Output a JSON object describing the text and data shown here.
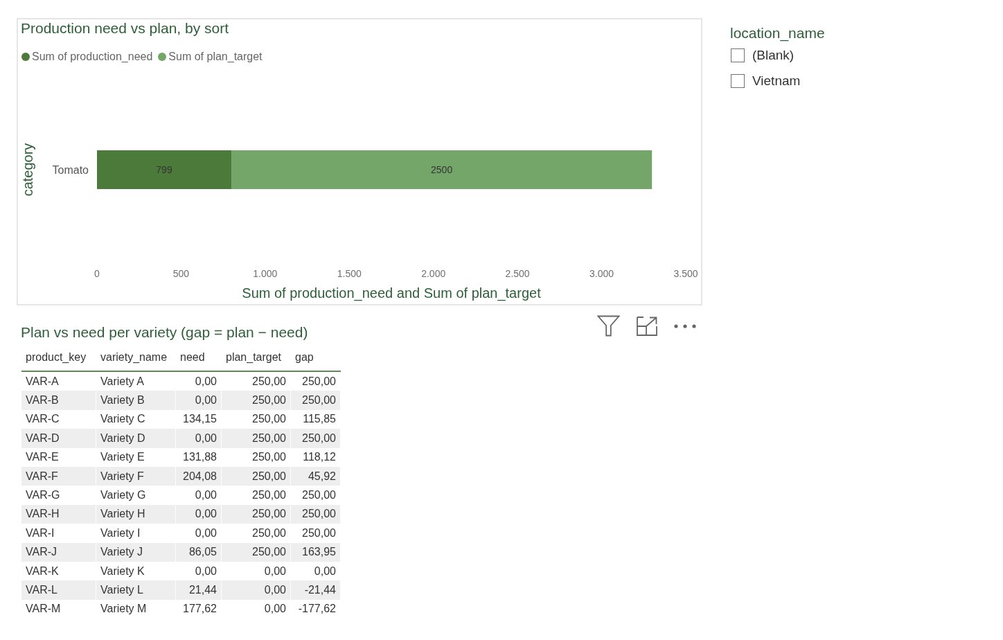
{
  "production_chart": {
    "chart_data": {
      "type": "bar",
      "orientation": "horizontal",
      "stacked": true,
      "title": "Production need vs plan, by sort",
      "legend": "top-left",
      "xlabel": "Sum of production_need and Sum of plan_target",
      "ylabel": "category",
      "categories": [
        "Tomato"
      ],
      "series": [
        {
          "name": "Sum of production_need",
          "color": "#4c7a3a",
          "values": [
            799
          ]
        },
        {
          "name": "Sum of plan_target",
          "color": "#74a669",
          "values": [
            2500
          ]
        }
      ],
      "xlim": [
        0,
        3500
      ],
      "xticks": [
        {
          "value": 0,
          "label": "0"
        },
        {
          "value": 500,
          "label": "500"
        },
        {
          "value": 1000,
          "label": "1.000"
        },
        {
          "value": 1500,
          "label": "1.500"
        },
        {
          "value": 2000,
          "label": "2.000"
        },
        {
          "value": 2500,
          "label": "2.500"
        },
        {
          "value": 3000,
          "label": "3.000"
        },
        {
          "value": 3500,
          "label": "3.500"
        }
      ],
      "data_labels": true
    }
  },
  "variety_table": {
    "title": "Plan vs need per variety (gap = plan − need)",
    "columns": [
      {
        "label": "product_key",
        "kind": "text"
      },
      {
        "label": "variety_name",
        "kind": "text"
      },
      {
        "label": "need",
        "kind": "number"
      },
      {
        "label": "plan_target",
        "kind": "number"
      },
      {
        "label": "gap",
        "kind": "number"
      }
    ],
    "rows": [
      [
        "VAR-A",
        "Variety A",
        "0,00",
        "250,00",
        "250,00"
      ],
      [
        "VAR-B",
        "Variety B",
        "0,00",
        "250,00",
        "250,00"
      ],
      [
        "VAR-C",
        "Variety C",
        "134,15",
        "250,00",
        "115,85"
      ],
      [
        "VAR-D",
        "Variety D",
        "0,00",
        "250,00",
        "250,00"
      ],
      [
        "VAR-E",
        "Variety E",
        "131,88",
        "250,00",
        "118,12"
      ],
      [
        "VAR-F",
        "Variety F",
        "204,08",
        "250,00",
        "45,92"
      ],
      [
        "VAR-G",
        "Variety G",
        "0,00",
        "250,00",
        "250,00"
      ],
      [
        "VAR-H",
        "Variety H",
        "0,00",
        "250,00",
        "250,00"
      ],
      [
        "VAR-I",
        "Variety I",
        "0,00",
        "250,00",
        "250,00"
      ],
      [
        "VAR-J",
        "Variety J",
        "86,05",
        "250,00",
        "163,95"
      ],
      [
        "VAR-K",
        "Variety K",
        "0,00",
        "0,00",
        "0,00"
      ],
      [
        "VAR-L",
        "Variety L",
        "21,44",
        "0,00",
        "-21,44"
      ],
      [
        "VAR-M",
        "Variety M",
        "177,62",
        "0,00",
        "-177,62"
      ]
    ]
  },
  "location_slicer": {
    "title": "location_name",
    "items": [
      {
        "label": "(Blank)",
        "checked": false
      },
      {
        "label": "Vietnam",
        "checked": false
      }
    ]
  }
}
